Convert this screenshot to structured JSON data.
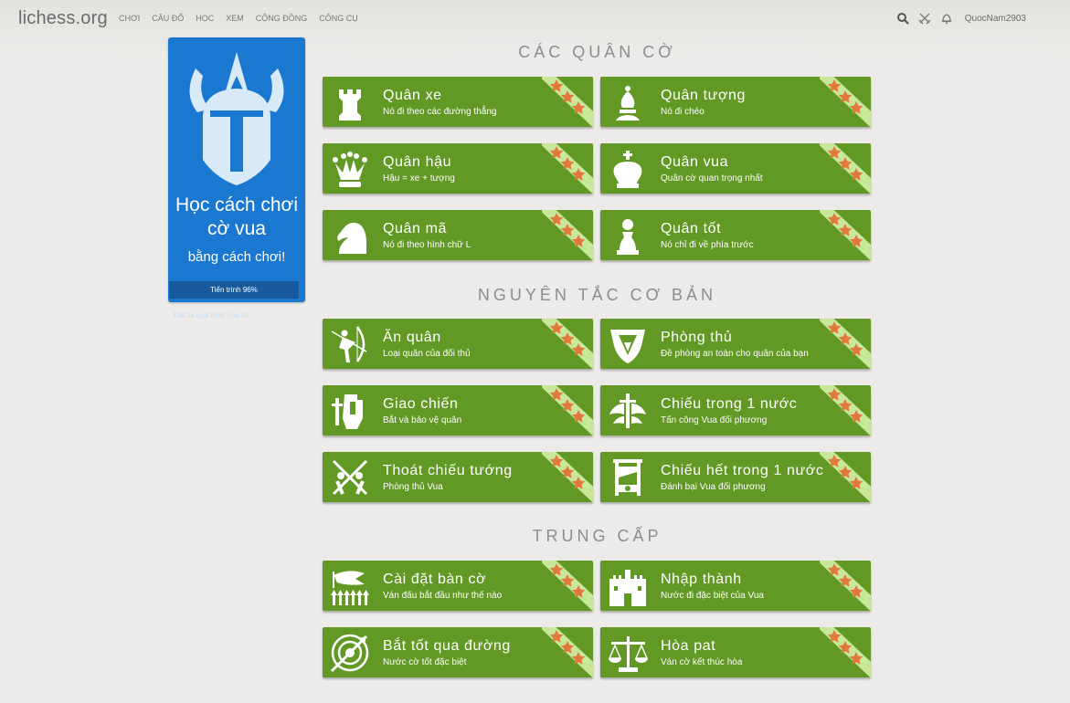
{
  "header": {
    "logo": "lichess.org",
    "nav": [
      "CHƠI",
      "CÂU ĐỐ",
      "HỌC",
      "XEM",
      "CỘNG ĐỒNG",
      "CÔNG CỤ"
    ],
    "username": "QuocNam2903"
  },
  "sidebar": {
    "title": "Học cách chơi cờ vua",
    "subtitle": "bằng cách chơi!",
    "progress_label": "Tiến trình 96%",
    "progress_value": 0.96,
    "reset_link": "Đặt lại quá trình của tôi"
  },
  "sections": [
    {
      "title": "CÁC QUÂN CỜ",
      "cards": [
        {
          "name": "Quân xe",
          "desc": "Nó đi theo các đường thẳng",
          "icon": "rook-icon"
        },
        {
          "name": "Quân tượng",
          "desc": "Nó đi chéo",
          "icon": "bishop-icon"
        },
        {
          "name": "Quân hậu",
          "desc": "Hậu = xe + tượng",
          "icon": "queen-icon"
        },
        {
          "name": "Quân vua",
          "desc": "Quân cờ quan trọng nhất",
          "icon": "king-icon"
        },
        {
          "name": "Quân mã",
          "desc": "Nó đi theo hình chữ L",
          "icon": "knight-icon"
        },
        {
          "name": "Quân tốt",
          "desc": "Nó chỉ đi về phía trước",
          "icon": "pawn-icon"
        }
      ]
    },
    {
      "title": "NGUYÊN TẮC CƠ BẢN",
      "cards": [
        {
          "name": "Ăn quân",
          "desc": "Loại quân của đối thủ",
          "icon": "archer-icon"
        },
        {
          "name": "Phòng thủ",
          "desc": "Đề phòng an toàn cho quân của bạn",
          "icon": "shield-icon"
        },
        {
          "name": "Giao chiến",
          "desc": "Bắt và bảo vệ quân",
          "icon": "knight-sword-icon"
        },
        {
          "name": "Chiếu trong 1 nước",
          "desc": "Tấn công Vua đối phương",
          "icon": "winged-sword-icon"
        },
        {
          "name": "Thoát chiếu tướng",
          "desc": "Phòng thủ Vua",
          "icon": "crossed-swords-icon"
        },
        {
          "name": "Chiếu hết trong 1 nước",
          "desc": "Đánh bại Vua đối phương",
          "icon": "guillotine-icon"
        }
      ]
    },
    {
      "title": "TRUNG CẤP",
      "cards": [
        {
          "name": "Cài đặt bàn cờ",
          "desc": "Ván đấu bắt đầu như thế nào",
          "icon": "army-icon"
        },
        {
          "name": "Nhập thành",
          "desc": "Nước đi đặc biệt của Vua",
          "icon": "castle-icon"
        },
        {
          "name": "Bắt tốt qua đường",
          "desc": "Nước cờ tốt đặc biệt",
          "icon": "target-arrow-icon"
        },
        {
          "name": "Hòa pat",
          "desc": "Ván cờ kết thúc hòa",
          "icon": "scales-icon"
        }
      ]
    }
  ],
  "colors": {
    "card": "#629924",
    "sidebar": "#1b78d0",
    "background": "#ecebe9",
    "ribbon": "#c9e79a",
    "star": "#e2793c"
  }
}
